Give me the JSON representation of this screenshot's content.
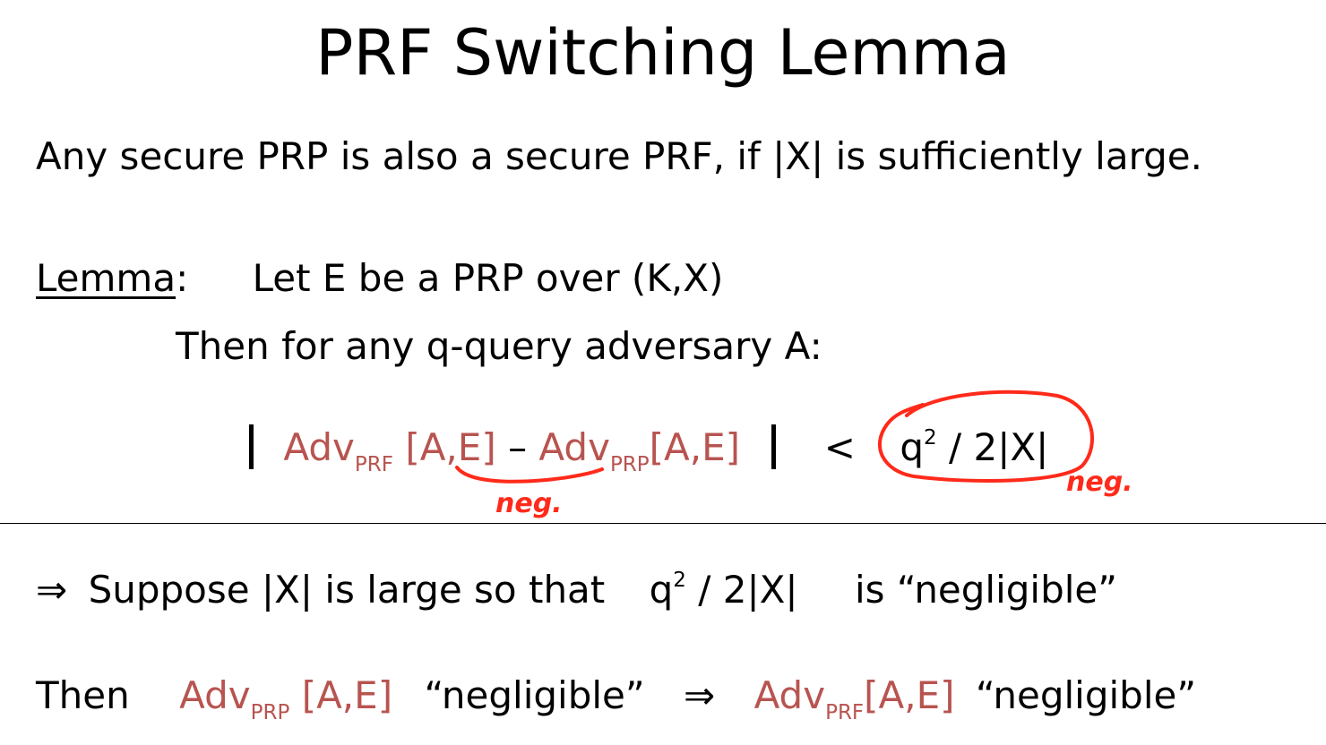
{
  "slide": {
    "title": "PRF Switching Lemma",
    "intro": "Any secure PRP is also a secure PRF,   if |X| is sufficiently large.",
    "lemma_label": "Lemma",
    "lemma_colon": ":",
    "lemma_text": "Let   E   be a PRP over  (K,X)",
    "lemma_then": "Then for any   q-query  adversary  A:",
    "formula": {
      "adv": "Adv",
      "prf_sub": "PRF",
      "prp_sub": "PRP",
      "args1": " [A,E]",
      "minus": "  –  ",
      "args2": "[A,E]",
      "lt": "<",
      "bound_q": "q",
      "bound_exp": "2",
      "bound_rest": " / 2|X|"
    },
    "implies_symbol": "⇒",
    "suppose_text": "Suppose |X| is large so that",
    "suppose_q": "q",
    "suppose_exp": "2",
    "suppose_rest": " / 2|X|",
    "suppose_tail": "is “negligible”",
    "then_word": "Then",
    "then_adv1": "Adv",
    "then_sub1": "PRP",
    "then_args1": " [A,E]",
    "then_neg1": "“negligible”",
    "then_arrow": "⇒",
    "then_adv2": "Adv",
    "then_sub2": "PRF",
    "then_args2": "[A,E]",
    "then_neg2": "“negligible”"
  },
  "annotations": {
    "neg_left": "neg.",
    "neg_right": "neg.",
    "ink_color": "#ff2a1a"
  },
  "colors": {
    "accent_red": "#b85450",
    "text": "#000000"
  }
}
